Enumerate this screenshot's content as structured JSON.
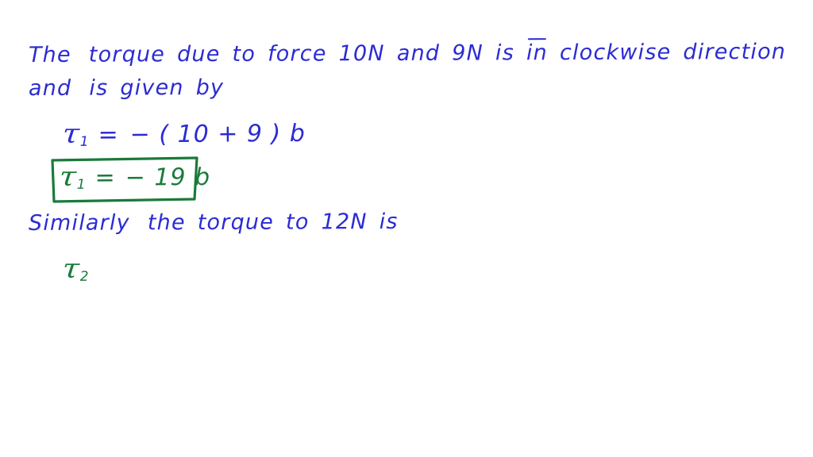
{
  "document": {
    "background_color": "#ffffff",
    "ink_colors": {
      "primary": "#2b2bd4",
      "highlight": "#1a7a3a"
    },
    "topic": "torque-calculation-handwritten-solution"
  },
  "lines": {
    "l1": {
      "w1": "The",
      "w2": "torque",
      "w3": "due",
      "w4": "to",
      "w5": "force",
      "w6": "10N",
      "w7": "and",
      "w8": "9N",
      "w9": "is",
      "w10": "in",
      "w11": "clockwise",
      "w12": "direction"
    },
    "l2": {
      "w1": "and",
      "w2": "is",
      "w3": "given",
      "w4": "by"
    },
    "eq1": {
      "tau": "τ",
      "sub": "1",
      "equals": "=",
      "rhs": "− ( 10 + 9 ) b"
    },
    "eq2_boxed": {
      "tau": "τ",
      "sub": "1",
      "equals": "=",
      "rhs": "− 19 b"
    },
    "l3": {
      "w1": "Similarly",
      "w2": "the",
      "w3": "torque",
      "w4": "to",
      "w5": "12N",
      "w6": "is"
    },
    "eq3": {
      "tau": "τ",
      "sub": "2"
    }
  }
}
